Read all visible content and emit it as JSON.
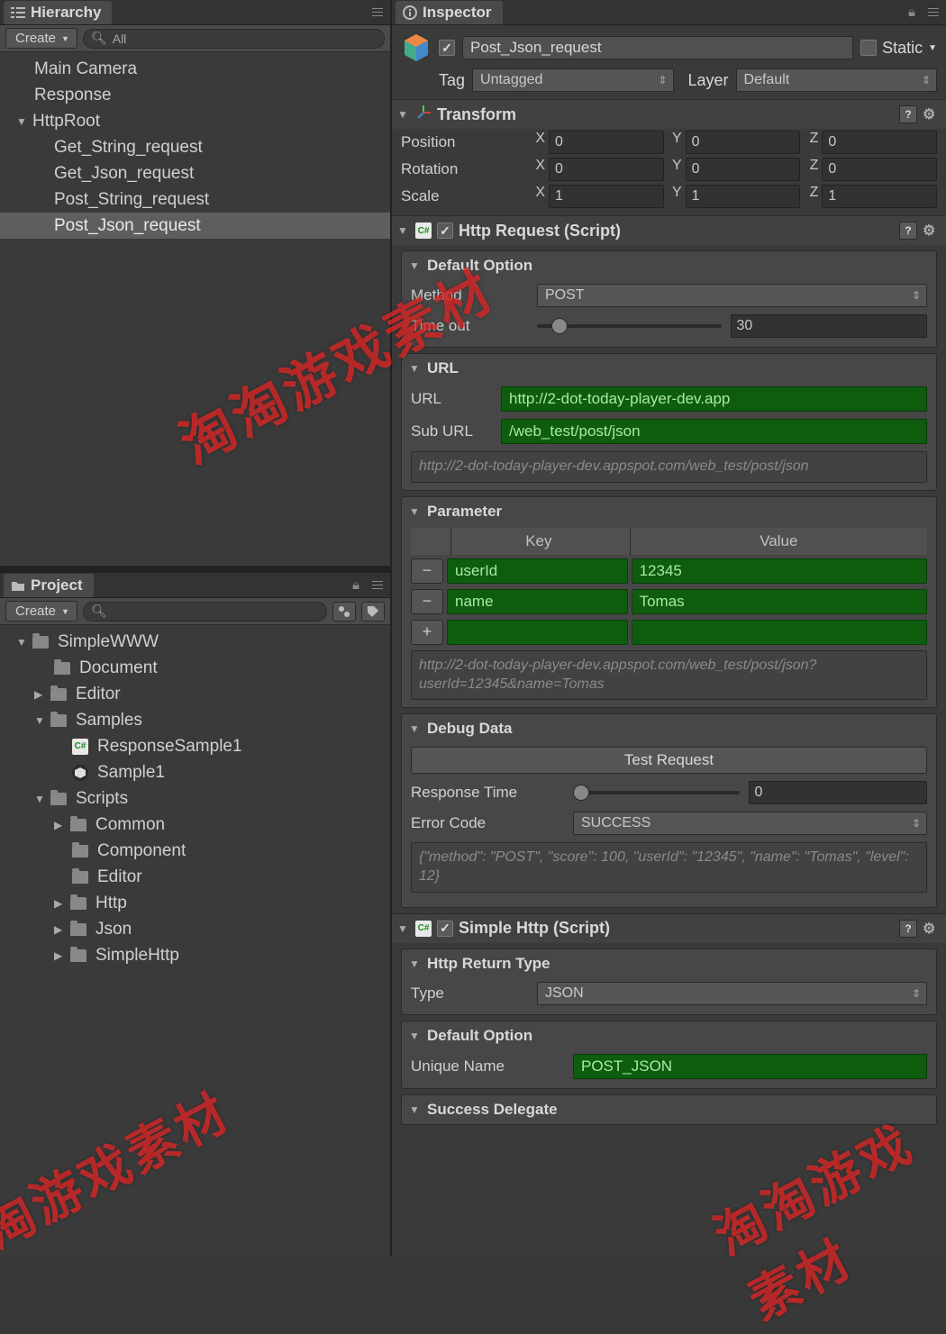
{
  "hierarchy": {
    "tab": "Hierarchy",
    "create": "Create",
    "search_placeholder": "All",
    "items": {
      "i0": "Main Camera",
      "i1": "Response",
      "i2": "HttpRoot",
      "i3": "Get_String_request",
      "i4": "Get_Json_request",
      "i5": "Post_String_request",
      "i6": "Post_Json_request"
    }
  },
  "project": {
    "tab": "Project",
    "create": "Create",
    "tree": {
      "t0": "SimpleWWW",
      "t1": "Document",
      "t2": "Editor",
      "t3": "Samples",
      "t4": "ResponseSample1",
      "t5": "Sample1",
      "t6": "Scripts",
      "t7": "Common",
      "t8": "Component",
      "t9": "Editor",
      "t10": "Http",
      "t11": "Json",
      "t12": "SimpleHttp"
    }
  },
  "inspector": {
    "tab": "Inspector",
    "static": "Static",
    "name": "Post_Json_request",
    "tag_lbl": "Tag",
    "tag_val": "Untagged",
    "layer_lbl": "Layer",
    "layer_val": "Default",
    "transform": {
      "title": "Transform",
      "position_lbl": "Position",
      "px": "0",
      "py": "0",
      "pz": "0",
      "rotation_lbl": "Rotation",
      "rx": "0",
      "ry": "0",
      "rz": "0",
      "scale_lbl": "Scale",
      "sx": "1",
      "sy": "1",
      "sz": "1",
      "x": "X",
      "y": "Y",
      "z": "Z"
    },
    "http": {
      "title": "Http Request (Script)",
      "default_opt": "Default Option",
      "method_lbl": "Method",
      "method_val": "POST",
      "timeout_lbl": "Time out",
      "timeout_val": "30",
      "url_section": "URL",
      "url_lbl": "URL",
      "url_val": "http://2-dot-today-player-dev.app",
      "suburl_lbl": "Sub URL",
      "suburl_val": "/web_test/post/json",
      "url_preview": "http://2-dot-today-player-dev.appspot.com/web_test/post/json",
      "param_section": "Parameter",
      "key_hdr": "Key",
      "val_hdr": "Value",
      "params": [
        {
          "k": "userId",
          "v": "12345"
        },
        {
          "k": "name",
          "v": "Tomas"
        }
      ],
      "param_preview": "http://2-dot-today-player-dev.appspot.com/web_test/post/json?userId=12345&name=Tomas",
      "debug_section": "Debug Data",
      "test_btn": "Test Request",
      "resp_time_lbl": "Response Time",
      "resp_time_val": "0",
      "err_lbl": "Error Code",
      "err_val": "SUCCESS",
      "debug_json": "{\"method\": \"POST\", \"score\": 100, \"userId\": \"12345\", \"name\": \"Tomas\", \"level\": 12}"
    },
    "simple": {
      "title": "Simple Http (Script)",
      "return_section": "Http Return Type",
      "type_lbl": "Type",
      "type_val": "JSON",
      "default_opt": "Default Option",
      "unique_lbl": "Unique Name",
      "unique_val": "POST_JSON",
      "success_section": "Success Delegate"
    }
  },
  "watermark": "淘淘游戏素材"
}
